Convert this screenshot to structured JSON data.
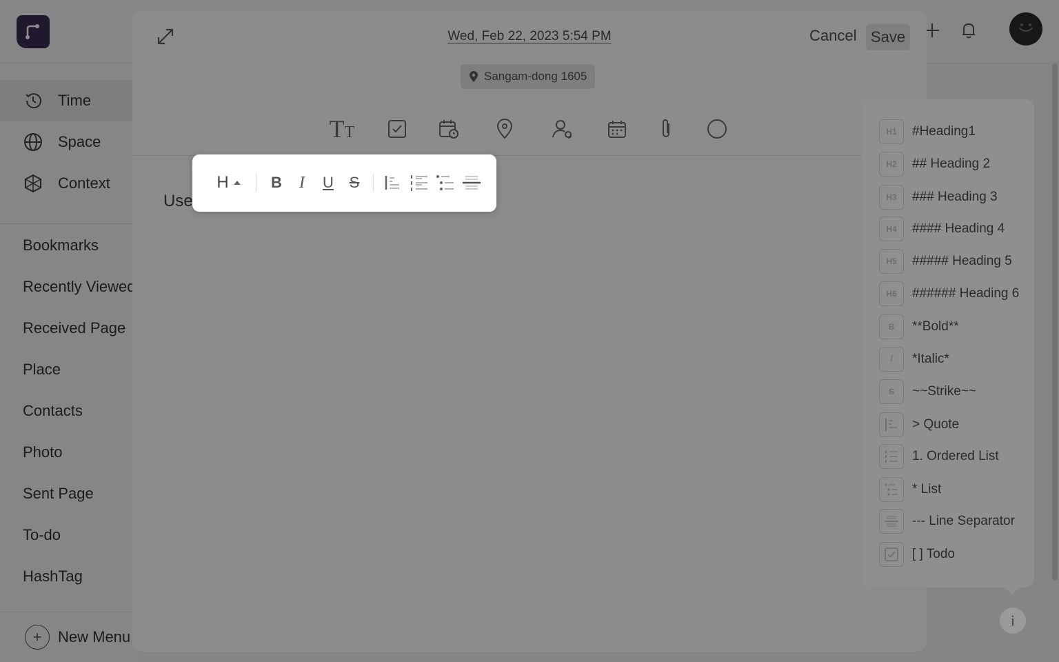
{
  "sidebar": {
    "main": [
      {
        "label": "Time",
        "icon": "history-icon"
      },
      {
        "label": "Space",
        "icon": "globe-icon"
      },
      {
        "label": "Context",
        "icon": "context-icon"
      }
    ],
    "sub": [
      "Bookmarks",
      "Recently Viewed",
      "Received Page",
      "Place",
      "Contacts",
      "Photo",
      "Sent Page",
      "To-do",
      "HashTag"
    ],
    "new_menu": "New Menu"
  },
  "modal": {
    "date": "Wed, Feb 22, 2023 5:54 PM",
    "cancel_label": "Cancel",
    "save_label": "Save",
    "location": "Sangam-dong 1605",
    "editor_text": "Use",
    "toolbar_icons": [
      "text-size-icon",
      "checkbox-icon",
      "calendar-clock-icon",
      "location-pin-icon",
      "user-mention-icon",
      "calendar-icon",
      "paperclip-icon",
      "circle-icon"
    ]
  },
  "format_popup": {
    "heading": "H",
    "bold": "B",
    "italic": "I",
    "underline": "U",
    "strike": "S"
  },
  "markdown_help": [
    {
      "badge": "H1",
      "text": "#Heading1"
    },
    {
      "badge": "H2",
      "text": "## Heading 2"
    },
    {
      "badge": "H3",
      "text": "### Heading 3"
    },
    {
      "badge": "H4",
      "text": "#### Heading 4"
    },
    {
      "badge": "H5",
      "text": "##### Heading 5"
    },
    {
      "badge": "H6",
      "text": "###### Heading 6"
    },
    {
      "badge": "B",
      "text": "**Bold**"
    },
    {
      "badge": "I",
      "text": "*Italic*"
    },
    {
      "badge": "S",
      "text": "~~Strike~~"
    },
    {
      "badge": "quote",
      "text": "> Quote"
    },
    {
      "badge": "ol",
      "text": "1. Ordered List"
    },
    {
      "badge": "ul",
      "text": "* List"
    },
    {
      "badge": "hr",
      "text": "--- Line Separator"
    },
    {
      "badge": "todo",
      "text": "[ ] Todo"
    }
  ],
  "info_label": "i",
  "colors": {
    "logo": "#3b2f55",
    "overlay": "rgba(0,0,0,0.45)"
  }
}
